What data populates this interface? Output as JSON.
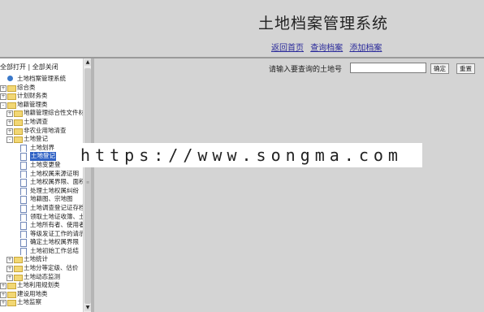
{
  "header": {
    "title": "土地档案管理系统",
    "nav": [
      "返回首页",
      "查询档案",
      "添加档案"
    ]
  },
  "sidebar": {
    "expand_all": "全部打开",
    "separator": "|",
    "collapse_all": "全部关闭",
    "tree": [
      {
        "label": "土地档案管理系统",
        "icon": "root-icon",
        "toggle": "",
        "level": 0
      },
      {
        "label": "综合类",
        "icon": "folder-icon",
        "toggle": "+",
        "level": 0
      },
      {
        "label": "计划财务类",
        "icon": "folder-icon",
        "toggle": "+",
        "level": 0
      },
      {
        "label": "地籍管理类",
        "icon": "folder-icon",
        "toggle": "-",
        "level": 0
      },
      {
        "label": "地籍管理综合性文件材",
        "icon": "folder-icon",
        "toggle": "+",
        "level": 1
      },
      {
        "label": "土地调查",
        "icon": "folder-icon",
        "toggle": "+",
        "level": 1
      },
      {
        "label": "非农业用地清查",
        "icon": "folder-icon",
        "toggle": "+",
        "level": 1
      },
      {
        "label": "土地登记",
        "icon": "folder-icon",
        "toggle": "-",
        "level": 1
      },
      {
        "label": "土地划界",
        "icon": "document-icon",
        "toggle": "",
        "level": 2
      },
      {
        "label": "土地登记",
        "icon": "document-icon",
        "toggle": "",
        "level": 2,
        "selected": true
      },
      {
        "label": "土地变更登记",
        "icon": "document-icon",
        "toggle": "",
        "level": 2
      },
      {
        "label": "土地权属来源证明",
        "icon": "document-icon",
        "toggle": "",
        "level": 2
      },
      {
        "label": "土地权属界限、面积",
        "icon": "document-icon",
        "toggle": "",
        "level": 2
      },
      {
        "label": "处理土地权属纠纷",
        "icon": "document-icon",
        "toggle": "",
        "level": 2
      },
      {
        "label": "地籍图、宗地图",
        "icon": "document-icon",
        "toggle": "",
        "level": 2
      },
      {
        "label": "土地调查登记证存档",
        "icon": "document-icon",
        "toggle": "",
        "level": 2
      },
      {
        "label": "领取土地证收簿、土",
        "icon": "document-icon",
        "toggle": "",
        "level": 2
      },
      {
        "label": "土地所有者、使用者",
        "icon": "document-icon",
        "toggle": "",
        "level": 2
      },
      {
        "label": "等级发证工作的请示",
        "icon": "document-icon",
        "toggle": "",
        "level": 2
      },
      {
        "label": "确定土地权属界限",
        "icon": "document-icon",
        "toggle": "",
        "level": 2
      },
      {
        "label": "土地初始工作总结",
        "icon": "document-icon",
        "toggle": "",
        "level": 2
      },
      {
        "label": "土地统计",
        "icon": "folder-icon",
        "toggle": "+",
        "level": 1
      },
      {
        "label": "土地分等定级、估价",
        "icon": "folder-icon",
        "toggle": "+",
        "level": 1
      },
      {
        "label": "土地动态监测",
        "icon": "folder-icon",
        "toggle": "+",
        "level": 1
      },
      {
        "label": "土地利用规划类",
        "icon": "folder-icon",
        "toggle": "+",
        "level": 0
      },
      {
        "label": "建设用地类",
        "icon": "folder-icon",
        "toggle": "+",
        "level": 0
      },
      {
        "label": "土地监察",
        "icon": "folder-icon",
        "toggle": "+",
        "level": 0
      }
    ]
  },
  "search": {
    "label": "请输入要查询的土地号",
    "value": "",
    "confirm_label": "确定",
    "reset_label": "重置"
  },
  "watermark": {
    "text": "https://www.songma.com"
  },
  "colors": {
    "background": "#d4d4d4",
    "selected": "#3163c5",
    "link": "#2a2a9a"
  }
}
